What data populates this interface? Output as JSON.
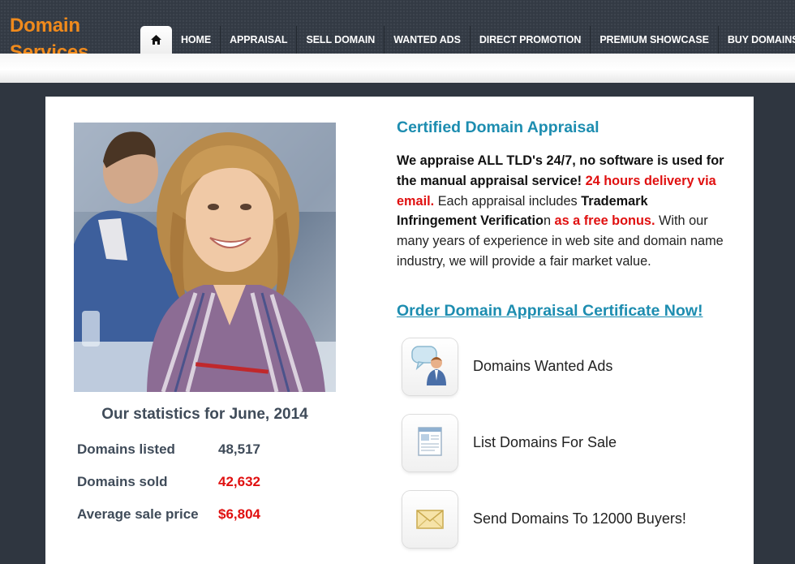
{
  "header": {
    "logo_line1": "Domain",
    "logo_line2": "Services",
    "nav": [
      "HOME",
      "APPRAISAL",
      "SELL DOMAIN",
      "WANTED ADS",
      "DIRECT PROMOTION",
      "PREMIUM SHOWCASE",
      "BUY DOMAINS"
    ]
  },
  "stats": {
    "title": "Our statistics for June, 2014",
    "rows": [
      {
        "label": "Domains listed",
        "value": "48,517"
      },
      {
        "label": "Domains sold",
        "value": "42,632"
      },
      {
        "label": "Average sale price",
        "value": "$6,804"
      }
    ]
  },
  "appraisal": {
    "title": "Certified Domain Appraisal",
    "p1": "We appraise ALL TLD's 24/7, no software is used for the manual appraisal service!",
    "p2": " 24 hours delivery via email.",
    "p3": " Each appraisal includes ",
    "p4": "Trademark Infringement Verificatio",
    "p5": "n ",
    "p6": "as a free bonus.",
    "p7": " With our many years of experience in  web site and domain name industry, we will provide a fair market value.",
    "order_link": "Order Domain Appraisal Certificate Now!"
  },
  "features": [
    {
      "label": "Domains Wanted Ads",
      "icon": "wanted-ads-icon"
    },
    {
      "label": "List Domains For Sale",
      "icon": "list-domains-icon"
    },
    {
      "label": "Send Domains To 12000 Buyers!",
      "icon": "envelope-icon"
    }
  ],
  "colors": {
    "accent_orange": "#f08a1c",
    "link_blue": "#1d8db0",
    "highlight_red": "#e01010",
    "frame": "#2f3640"
  }
}
